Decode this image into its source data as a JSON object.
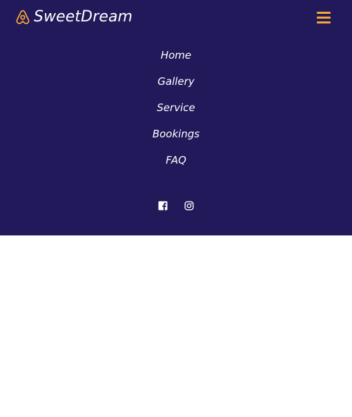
{
  "colors": {
    "navbar_background": "#21195a",
    "accent": "#f7a733",
    "text": "#ffffff"
  },
  "brand": {
    "name": "SweetDream",
    "icon": "airbnb-logo-icon"
  },
  "menu_toggle": {
    "icon": "hamburger-menu-icon"
  },
  "nav": {
    "items": [
      {
        "label": "Home"
      },
      {
        "label": "Gallery"
      },
      {
        "label": "Service"
      },
      {
        "label": "Bookings"
      },
      {
        "label": "FAQ"
      }
    ]
  },
  "social": {
    "icons": [
      "facebook-icon",
      "instagram-icon"
    ]
  }
}
